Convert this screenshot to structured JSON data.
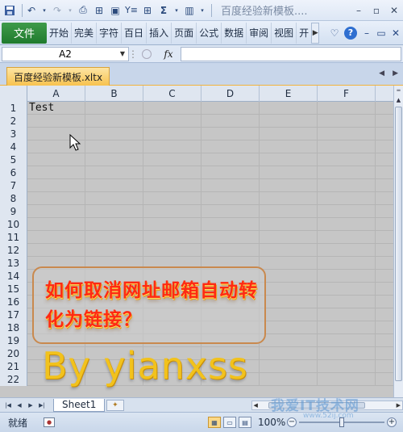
{
  "window": {
    "title": "百度经验新模板....",
    "minimize": "–",
    "restore": "▫",
    "close": "✕"
  },
  "quick_access": {
    "icons": [
      "save-icon",
      "undo-icon",
      "redo-icon",
      "print-preview-icon",
      "format-icon",
      "camera-icon",
      "filter-icon",
      "borders-icon",
      "sum-icon",
      "chart-icon",
      "customize-icon"
    ]
  },
  "ribbon": {
    "file_tab": "文件",
    "tabs": [
      "开始",
      "完美",
      "字符",
      "百日",
      "插入",
      "页面",
      "公式",
      "数据",
      "审阅",
      "视图",
      "开"
    ],
    "help": "?"
  },
  "formula_bar": {
    "name_box": "A2",
    "fx": "fx",
    "formula": ""
  },
  "document": {
    "tab_label": "百度经验新模板.xltx"
  },
  "grid": {
    "columns": [
      "A",
      "B",
      "C",
      "D",
      "E",
      "F"
    ],
    "rows": [
      "1",
      "2",
      "3",
      "4",
      "5",
      "6",
      "7",
      "8",
      "9",
      "10",
      "11",
      "12",
      "13",
      "14",
      "15",
      "16",
      "17",
      "18",
      "19",
      "20",
      "21",
      "22"
    ],
    "cells": {
      "A1": "Test"
    }
  },
  "overlay": {
    "banner_text": "如何取消网址邮箱自动转化为链接？",
    "signature": "By  yianxss"
  },
  "sheets": {
    "tabs": [
      "Sheet1"
    ]
  },
  "status_bar": {
    "ready": "就绪",
    "zoom": "100%",
    "zoom_value": 100,
    "minus": "−",
    "plus": "+"
  },
  "watermark": {
    "text": "我爱IT技术网",
    "sub": "www.52ij.com"
  }
}
